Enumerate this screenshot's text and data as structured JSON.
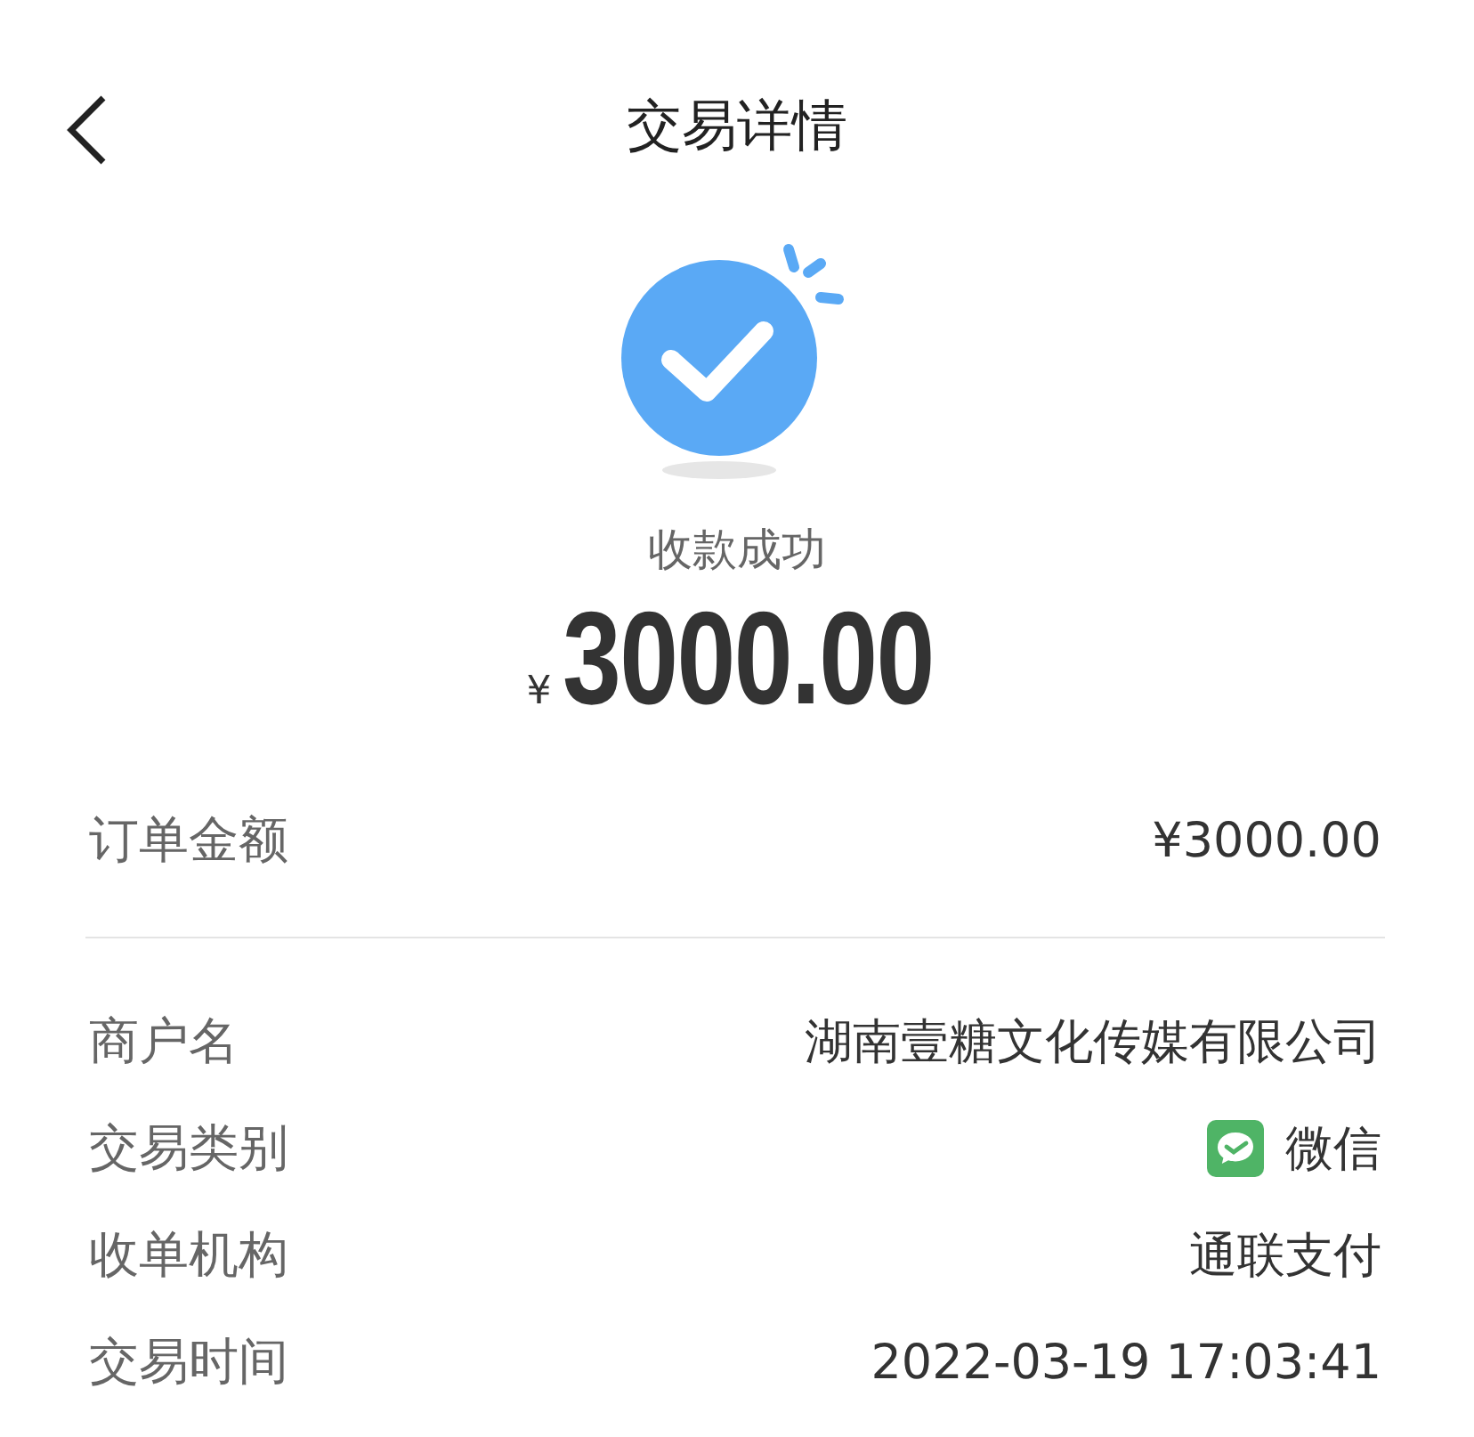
{
  "header": {
    "title": "交易详情"
  },
  "status": {
    "text": "收款成功",
    "currency": "¥",
    "amount": "3000.00"
  },
  "summary": {
    "label": "订单金额",
    "value": "¥3000.00"
  },
  "details": [
    {
      "label": "商户名",
      "value": "湖南壹糖文化传媒有限公司",
      "kind": "text"
    },
    {
      "label": "交易类别",
      "value": "微信",
      "kind": "wechat"
    },
    {
      "label": "收单机构",
      "value": "通联支付",
      "kind": "text"
    },
    {
      "label": "交易时间",
      "value": "2022-03-19 17:03:41",
      "kind": "text"
    }
  ]
}
